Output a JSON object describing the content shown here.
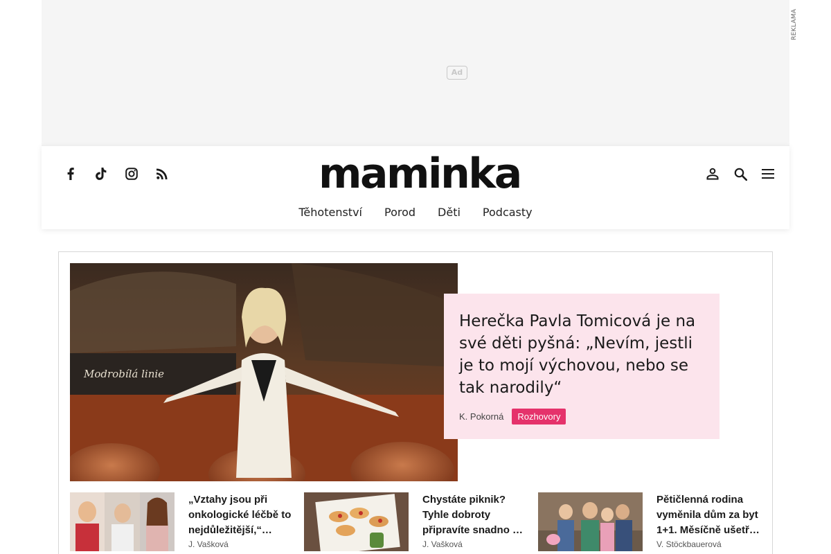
{
  "ad": {
    "badge": "Ad",
    "label": "REKLAMA"
  },
  "header": {
    "logo": "maminka",
    "social": [
      "facebook-icon",
      "tiktok-icon",
      "instagram-icon",
      "rss-icon"
    ],
    "tools": [
      "user-icon",
      "search-icon",
      "menu-icon"
    ],
    "nav": [
      "Těhotenství",
      "Porod",
      "Děti",
      "Podcasty"
    ]
  },
  "colors": {
    "accent": "#e5326b",
    "card_bg": "#fce4ec"
  },
  "hero": {
    "title": "Herečka Pavla Tomicová je na své děti pyšná: „Nevím, jestli je to mojí výchovou, nebo se tak narodily“",
    "author": "K. Pokorná",
    "tag": "Rozhovory",
    "image_sign": "Modrobílá linie"
  },
  "teasers": [
    {
      "title": "„Vztahy jsou při onkologické léčbě to nejdůležitější,“ říká…",
      "author": "J. Vašková"
    },
    {
      "title": "Chystáte piknik? Tyhle dobroty připravíte snadno …",
      "author": "J. Vašková"
    },
    {
      "title": "Pětičlenná rodina vyměnila dům za byt 1+1. Měsíčně ušetř…",
      "author": "V. Stöckbauerová"
    }
  ]
}
